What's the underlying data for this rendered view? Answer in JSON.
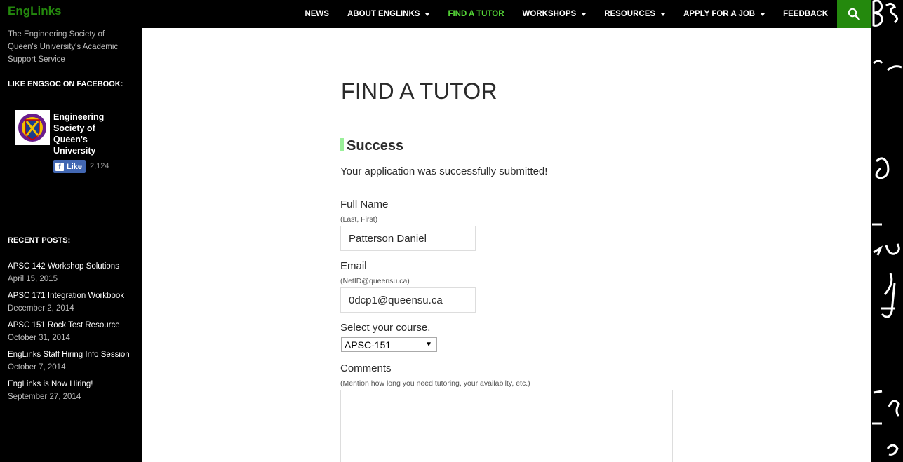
{
  "header": {
    "site_title": "EngLinks",
    "nav": [
      {
        "label": "NEWS",
        "dropdown": false,
        "active": false
      },
      {
        "label": "ABOUT ENGLINKS",
        "dropdown": true,
        "active": false
      },
      {
        "label": "FIND A TUTOR",
        "dropdown": false,
        "active": true
      },
      {
        "label": "WORKSHOPS",
        "dropdown": true,
        "active": false
      },
      {
        "label": "RESOURCES",
        "dropdown": true,
        "active": false
      },
      {
        "label": "APPLY FOR A JOB",
        "dropdown": true,
        "active": false
      },
      {
        "label": "FEEDBACK",
        "dropdown": false,
        "active": false
      }
    ],
    "search_icon": "search-icon"
  },
  "sidebar": {
    "tagline": "The Engineering Society of Queen's University's Academic Support Service",
    "facebook_widget": {
      "title": "LIKE ENGSOC ON FACEBOOK:",
      "page_name": "Engineering Society of Queen's University",
      "like_label": "Like",
      "like_count": "2,124"
    },
    "recent_posts": {
      "title": "RECENT POSTS:",
      "items": [
        {
          "title": "APSC 142 Workshop Solutions",
          "date": "April 15, 2015"
        },
        {
          "title": "APSC 171 Integration Workbook",
          "date": "December 2, 2014"
        },
        {
          "title": "APSC 151 Rock Test Resource",
          "date": "October 31, 2014"
        },
        {
          "title": "EngLinks Staff Hiring Info Session",
          "date": "October 7, 2014"
        },
        {
          "title": "EngLinks is Now Hiring!",
          "date": "September 27, 2014"
        }
      ]
    }
  },
  "main": {
    "page_title": "FIND A TUTOR",
    "success_title": "Success",
    "success_message": "Your application was successfully submitted!",
    "form": {
      "full_name_label": "Full Name",
      "full_name_hint": "(Last, First)",
      "full_name_value": "Patterson Daniel",
      "email_label": "Email",
      "email_hint": "(NetID@queensu.ca)",
      "email_value": "0dcp1@queensu.ca",
      "course_label": "Select your course.",
      "course_value": "APSC-151",
      "comments_label": "Comments",
      "comments_hint": "(Mention how long you need tutoring, your availabilty, etc.)",
      "comments_value": ""
    }
  },
  "colors": {
    "brand_green": "#24890d",
    "active_nav_green": "#55d737",
    "success_accent": "#9af09a",
    "facebook_blue": "#4267b2"
  }
}
